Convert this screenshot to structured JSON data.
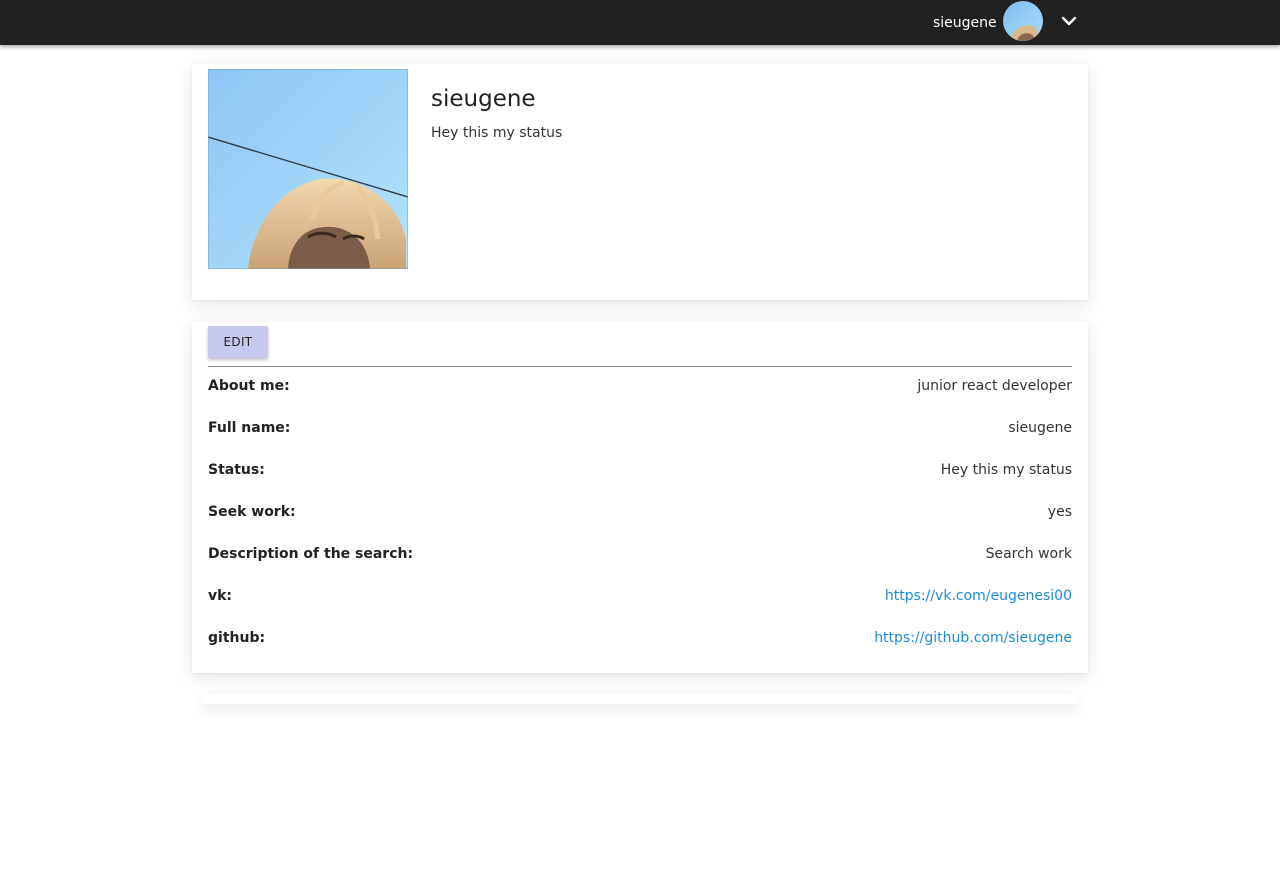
{
  "header": {
    "username": "sieugene"
  },
  "profile": {
    "name": "sieugene",
    "status": "Hey this my status"
  },
  "details": {
    "edit_label": "EDIT",
    "rows": [
      {
        "label": "About me:",
        "value": "junior react developer"
      },
      {
        "label": "Full name:",
        "value": "sieugene"
      },
      {
        "label": "Status:",
        "value": "Hey this my status"
      },
      {
        "label": "Seek work:",
        "value": "yes"
      },
      {
        "label": "Description of the search:",
        "value": "Search work"
      },
      {
        "label": "vk:",
        "value": "https://vk.com/eugenesi00"
      },
      {
        "label": "github:",
        "value": "https://github.com/sieugene"
      }
    ]
  },
  "icons": {
    "menu_toggle": "chevron-down-icon"
  },
  "colors": {
    "topbar": "#212121",
    "edit_button": "#c7c9ee",
    "link": "#1e8bd8"
  }
}
